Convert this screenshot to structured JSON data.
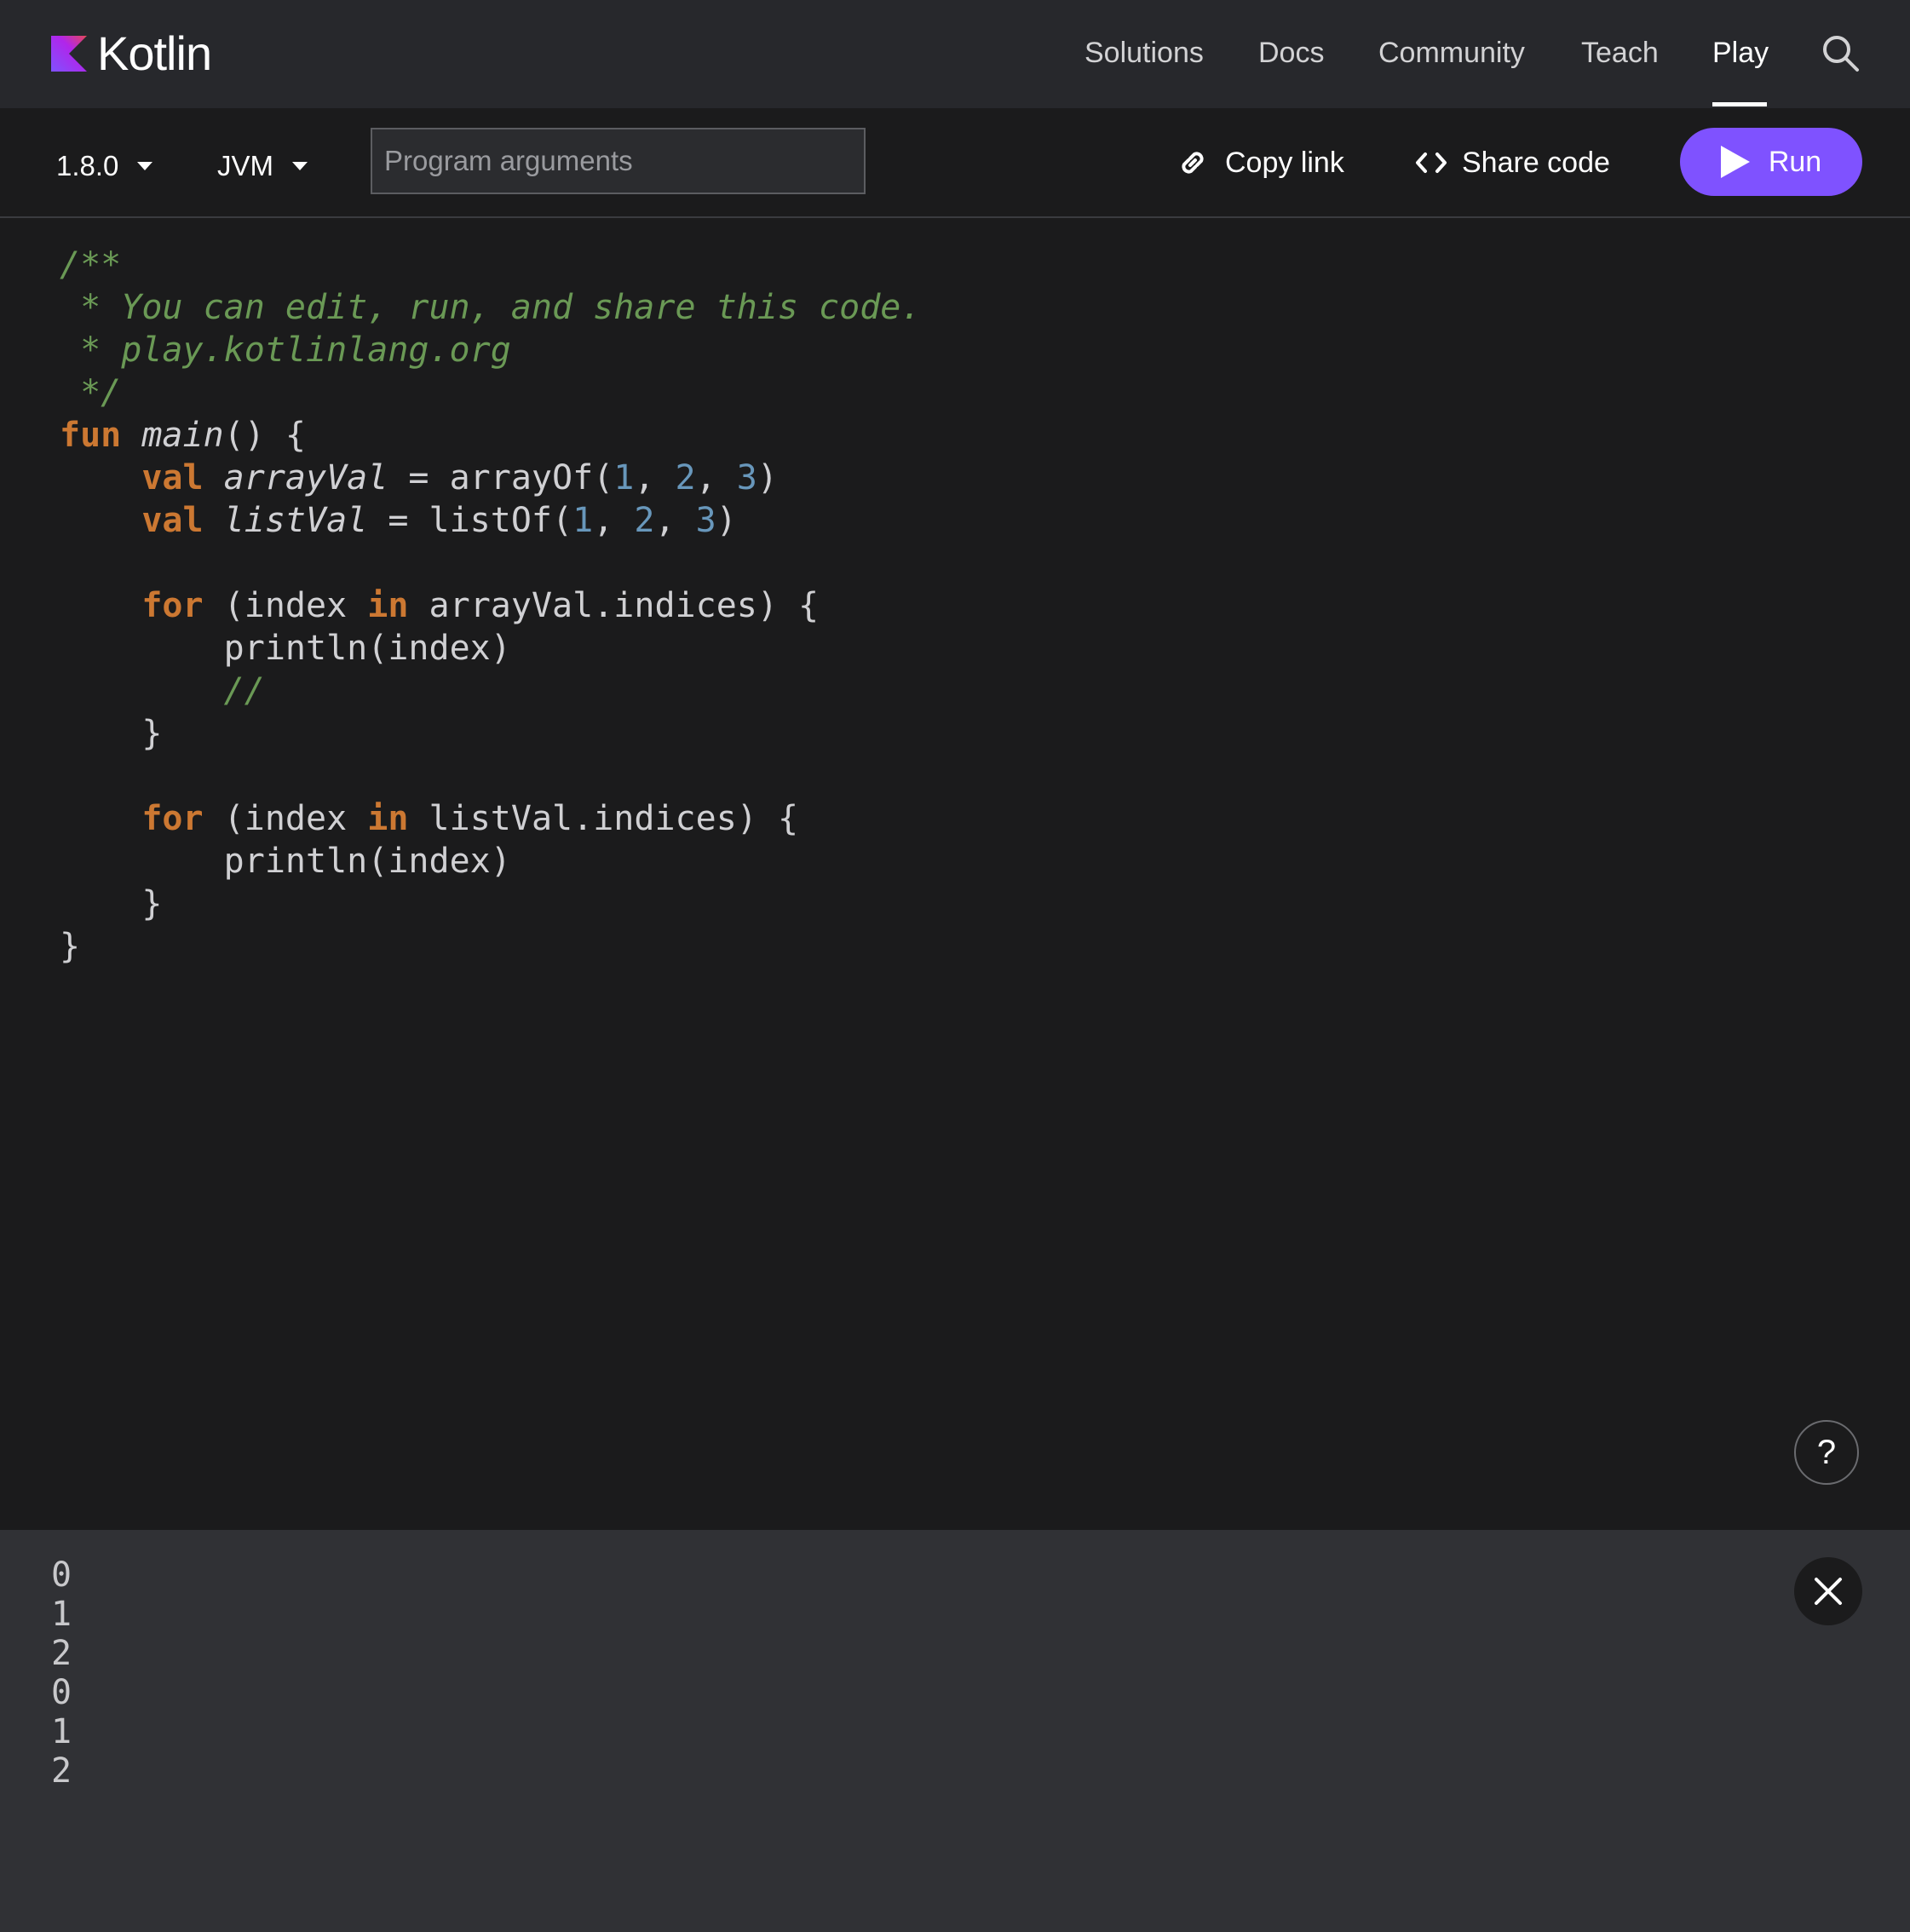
{
  "header": {
    "logo_text": "Kotlin",
    "nav": [
      {
        "label": "Solutions"
      },
      {
        "label": "Docs"
      },
      {
        "label": "Community"
      },
      {
        "label": "Teach"
      },
      {
        "label": "Play",
        "active": true
      }
    ]
  },
  "toolbar": {
    "version": "1.8.0",
    "platform": "JVM",
    "args_placeholder": "Program arguments",
    "args_value": "",
    "copy_link_label": "Copy link",
    "share_code_label": "Share code",
    "run_label": "Run"
  },
  "editor": {
    "lines": [
      "/**",
      " * You can edit, run, and share this code.",
      " * play.kotlinlang.org",
      " */",
      "fun main() {",
      "    val arrayVal = arrayOf(1, 2, 3)",
      "    val listVal = listOf(1, 2, 3)",
      "",
      "    for (index in arrayVal.indices) {",
      "        println(index)",
      "        //",
      "    }",
      "",
      "    for (index in listVal.indices) {",
      "        println(index)",
      "    }",
      "}"
    ],
    "help_label": "?"
  },
  "console": {
    "output": [
      "0",
      "1",
      "2",
      "0",
      "1",
      "2"
    ]
  },
  "colors": {
    "accent": "#7f52ff",
    "header_bg": "#27282c",
    "editor_bg": "#1b1b1c",
    "console_bg": "#303135",
    "comment": "#6a9955",
    "keyword": "#cc7832",
    "number": "#6897bb"
  },
  "icons": {
    "search": "search-icon",
    "copy_link": "link-icon",
    "share_code": "code-brackets-icon",
    "run": "play-icon",
    "close": "close-icon",
    "help": "help-icon"
  }
}
